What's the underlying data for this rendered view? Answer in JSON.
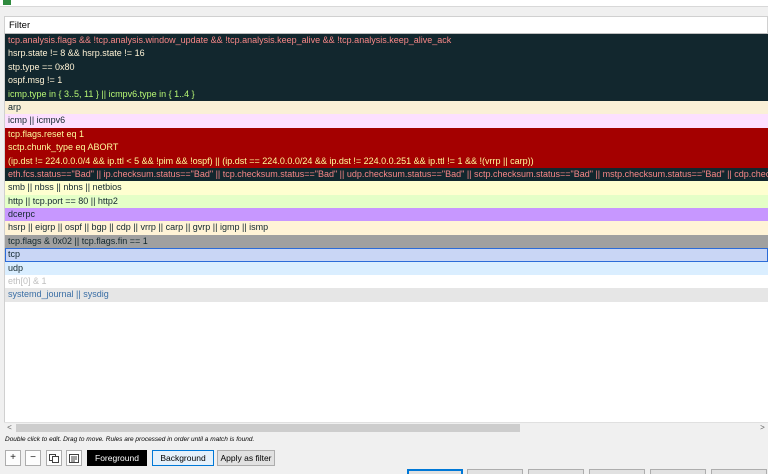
{
  "header": {
    "filter_label": "Filter"
  },
  "rules": [
    {
      "filter": "tcp.analysis.flags && !tcp.analysis.window_update && !tcp.analysis.keep_alive && !tcp.analysis.keep_alive_ack",
      "fg": "#f78787",
      "bg": "#12272e"
    },
    {
      "filter": "hsrp.state != 8 && hsrp.state != 16",
      "fg": "#fff3d6",
      "bg": "#12272e"
    },
    {
      "filter": "stp.type == 0x80",
      "fg": "#fff3d6",
      "bg": "#12272e"
    },
    {
      "filter": "ospf.msg != 1",
      "fg": "#fff3d6",
      "bg": "#12272e"
    },
    {
      "filter": "icmp.type in { 3..5, 11 } || icmpv6.type in { 1..4 }",
      "fg": "#b7f774",
      "bg": "#12272e"
    },
    {
      "filter": "arp",
      "fg": "#12272e",
      "bg": "#faf0d7"
    },
    {
      "filter": "icmp || icmpv6",
      "fg": "#12272e",
      "bg": "#fce0ff"
    },
    {
      "filter": "tcp.flags.reset eq 1",
      "fg": "#fffc9c",
      "bg": "#a40000"
    },
    {
      "filter": "sctp.chunk_type eq ABORT",
      "fg": "#fffc9c",
      "bg": "#a40000"
    },
    {
      "filter": "(ip.dst != 224.0.0.0/4 && ip.ttl < 5 && !pim && !ospf) || (ip.dst == 224.0.0.0/24 && ip.dst != 224.0.0.251 && ip.ttl != 1 && !(vrrp || carp))",
      "fg": "#fffc9c",
      "bg": "#a40000"
    },
    {
      "filter": "eth.fcs.status==\"Bad\" || ip.checksum.status==\"Bad\" || tcp.checksum.status==\"Bad\" || udp.checksum.status==\"Bad\" || sctp.checksum.status==\"Bad\" || mstp.checksum.status==\"Bad\" || cdp.checksum.status==\"Bad\"",
      "fg": "#f78787",
      "bg": "#12272e"
    },
    {
      "filter": "smb || nbss || nbns || netbios",
      "fg": "#12272e",
      "bg": "#feffd0"
    },
    {
      "filter": "http || tcp.port == 80 || http2",
      "fg": "#12272e",
      "bg": "#e4ffc7"
    },
    {
      "filter": "dcerpc",
      "fg": "#12272e",
      "bg": "#c797ff"
    },
    {
      "filter": "hsrp || eigrp || ospf || bgp || cdp || vrrp || carp || gvrp || igmp || ismp",
      "fg": "#12272e",
      "bg": "#fff3d6"
    },
    {
      "filter": "tcp.flags & 0x02 || tcp.flags.fin == 1",
      "fg": "#12272e",
      "bg": "#a0a0a0"
    },
    {
      "filter": "tcp",
      "fg": "#12272e",
      "bg": "#c9d6f5",
      "selected": true
    },
    {
      "filter": "udp",
      "fg": "#12272e",
      "bg": "#daeeff"
    },
    {
      "filter": "eth[0] & 1",
      "fg": "#bfbfbf",
      "bg": "#ffffff"
    },
    {
      "filter": "systemd_journal || sysdig",
      "fg": "#3a6ea5",
      "bg": "#e6e6e6"
    }
  ],
  "hint": "Double click to edit. Drag to move. Rules are processed in order until a match is found.",
  "toolbar": {
    "add_label": "+",
    "remove_label": "−",
    "foreground_label": "Foreground",
    "background_label": "Background",
    "apply_label": "Apply as filter"
  },
  "scrollbar": {
    "left_arrow": "<",
    "right_arrow": ">"
  }
}
